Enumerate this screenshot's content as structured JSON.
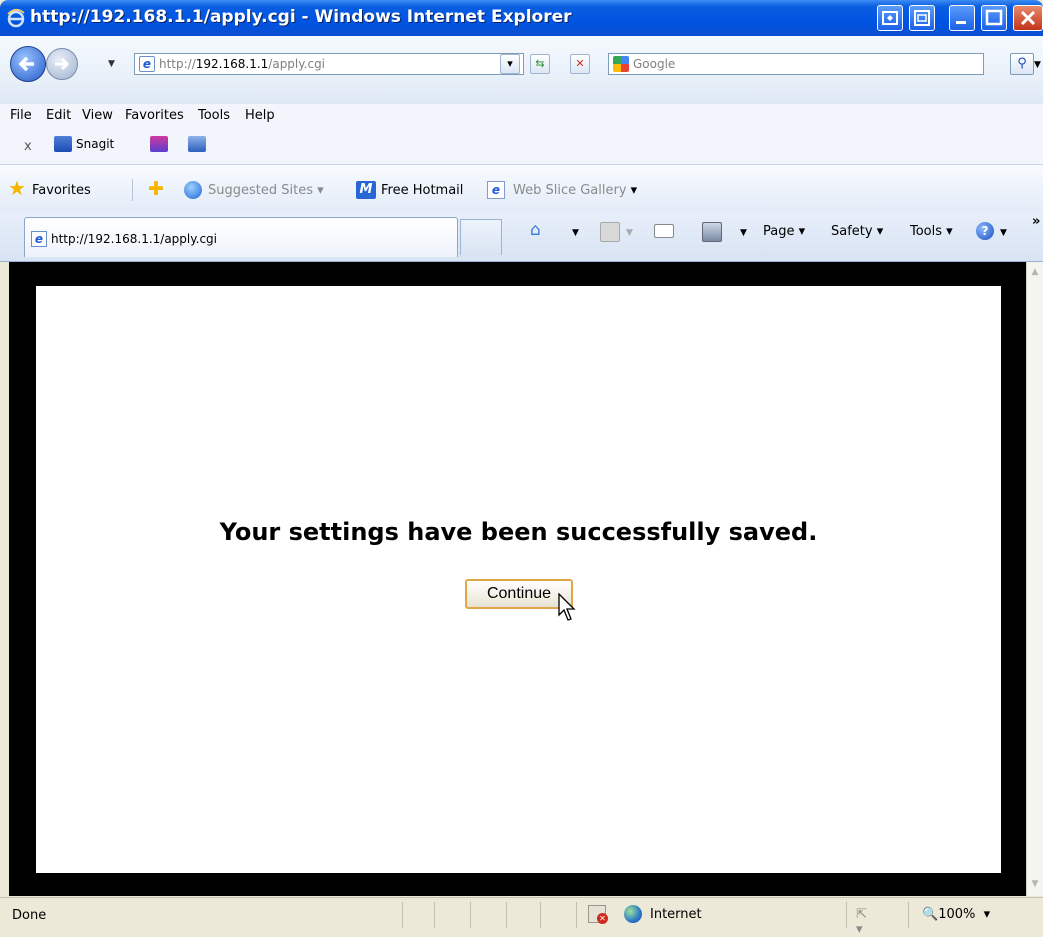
{
  "window": {
    "title": "http://192.168.1.1/apply.cgi - Windows Internet Explorer"
  },
  "address_bar": {
    "url_prefix": "http://",
    "url_host": "192.168.1.1",
    "url_path": "/apply.cgi",
    "search_placeholder": "Google"
  },
  "menu": {
    "items": [
      "File",
      "Edit",
      "View",
      "Favorites",
      "Tools",
      "Help"
    ]
  },
  "toolbar_snagit": {
    "close": "x",
    "label": "Snagit"
  },
  "favorites_bar": {
    "favorites_label": "Favorites",
    "suggested_sites": "Suggested Sites",
    "free_hotmail": "Free Hotmail",
    "web_slice_gallery": "Web Slice Gallery"
  },
  "tab": {
    "label": "http://192.168.1.1/apply.cgi"
  },
  "command_bar": {
    "page": "Page",
    "safety": "Safety",
    "tools": "Tools",
    "more": "»"
  },
  "content": {
    "message": "Your settings have been successfully saved.",
    "continue_label": "Continue"
  },
  "status_bar": {
    "status": "Done",
    "zone": "Internet",
    "zoom": "100%"
  },
  "colors": {
    "titlebar": "#0054e3",
    "frame_border": "#000000",
    "button_focus": "#e0a64a"
  }
}
